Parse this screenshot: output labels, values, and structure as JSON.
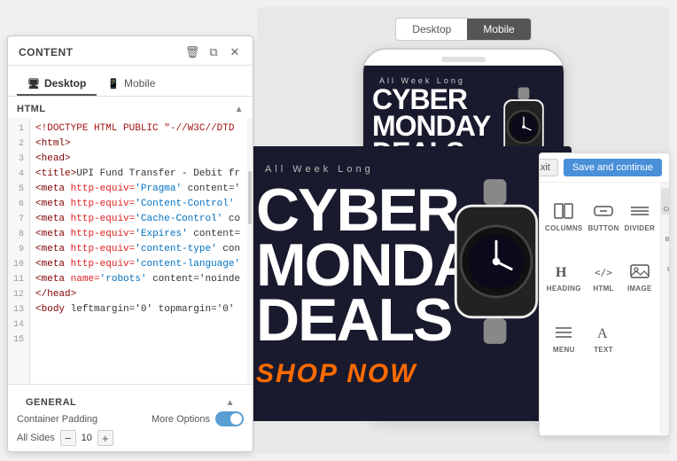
{
  "content_panel": {
    "title": "CONTENT",
    "tabs": [
      {
        "label": "Desktop",
        "icon": "🖥",
        "active": true
      },
      {
        "label": "Mobile",
        "icon": "📱",
        "active": false
      }
    ],
    "html_section": {
      "label": "HTML",
      "lines": [
        "<!DOCTYPE HTML PUBLIC \"-//W3C//DTD",
        "<html>",
        "<head>",
        "<title>UPI Fund Transfer - Debit fr",
        "<meta http-equiv='Pragma' content='",
        "<meta http-equiv='Content-Control'",
        "<meta http-equiv='Cache-Control' co",
        "<meta http-equiv='Expires' content=",
        "<meta http-equiv='content-type' con",
        "<meta http-equiv='content-language'",
        "<meta name='robots' content='noinde",
        "</head>",
        "<body leftmargin='0' topmargin='0'",
        "",
        ""
      ]
    },
    "general_section": {
      "label": "GENERAL",
      "container_padding_label": "Container Padding",
      "more_options_label": "More Options",
      "toggle_on": true,
      "all_sides_label": "All Sides",
      "padding_value": "10"
    }
  },
  "device_toggle": {
    "options": [
      "Desktop",
      "Mobile"
    ],
    "active": "Mobile"
  },
  "blocks_panel": {
    "exit_label": "Exit",
    "save_label": "Save and continue",
    "blocks": [
      {
        "icon": "columns",
        "label": "COLUMNS"
      },
      {
        "icon": "button",
        "label": "BUTTON"
      },
      {
        "icon": "divider",
        "label": "DIVIDER"
      },
      {
        "icon": "heading",
        "label": "HEADING"
      },
      {
        "icon": "html",
        "label": "HTML"
      },
      {
        "icon": "image",
        "label": "IMAGE"
      },
      {
        "icon": "menu",
        "label": "MENU"
      },
      {
        "icon": "text",
        "label": "TEXT"
      }
    ],
    "sidebar_tabs": [
      {
        "icon": "content",
        "label": "Content",
        "active": true
      },
      {
        "icon": "blocks",
        "label": "Blocks",
        "active": false
      },
      {
        "icon": "body",
        "label": "Body",
        "active": false
      }
    ]
  },
  "ad_content": {
    "all_week": "All Week Long",
    "line1": "CYBER",
    "line2": "MONDAY",
    "line3": "DEALS",
    "cta": "SHOP NOW"
  }
}
